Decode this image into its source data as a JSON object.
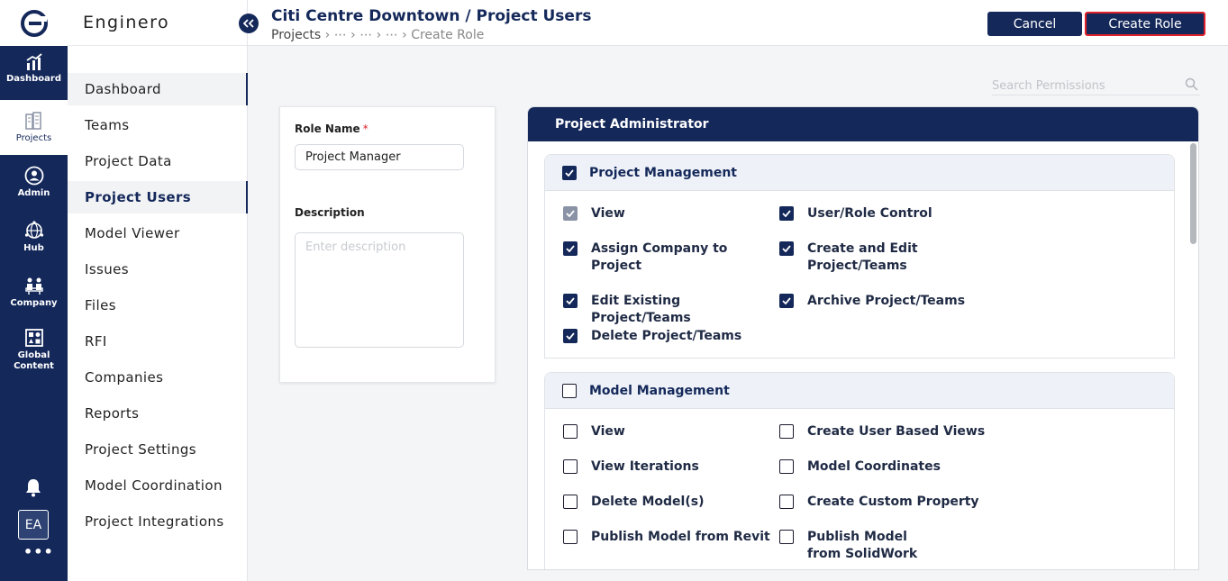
{
  "rail": {
    "items": [
      {
        "label": "Dashboard",
        "icon": "dashboard-chart-icon"
      },
      {
        "label": "Projects",
        "icon": "projects-buildings-icon"
      },
      {
        "label": "Admin",
        "icon": "admin-user-icon"
      },
      {
        "label": "Hub",
        "icon": "hub-globe-icon"
      },
      {
        "label": "Company",
        "icon": "company-people-icon"
      },
      {
        "label": "Global Content",
        "icon": "global-content-icon"
      }
    ],
    "avatar": "EA",
    "more": "•••"
  },
  "sidebar": {
    "brand": "Enginero",
    "items": [
      {
        "label": "Dashboard"
      },
      {
        "label": "Teams"
      },
      {
        "label": "Project Data"
      },
      {
        "label": "Project Users"
      },
      {
        "label": "Model Viewer"
      },
      {
        "label": "Issues"
      },
      {
        "label": "Files"
      },
      {
        "label": "RFI"
      },
      {
        "label": "Companies"
      },
      {
        "label": "Reports"
      },
      {
        "label": "Project Settings"
      },
      {
        "label": "Model Coordination"
      },
      {
        "label": "Project Integrations"
      }
    ]
  },
  "header": {
    "title": "Citi Centre Downtown / Project Users",
    "breadcrumb": {
      "root": "Projects",
      "middle": " › ⋯ › ⋯ › ⋯ › ",
      "current": "Create Role"
    },
    "cancel_label": "Cancel",
    "create_label": "Create Role"
  },
  "search": {
    "placeholder": "Search Permissions"
  },
  "role_form": {
    "role_name_label": "Role Name",
    "required_mark": "*",
    "role_name_value": "Project Manager",
    "description_label": "Description",
    "description_placeholder": "Enter description"
  },
  "permissions": {
    "title": "Project Administrator",
    "groups": [
      {
        "name": "Project Management",
        "checked": true,
        "items": [
          {
            "label": "View",
            "checked": true,
            "disabled": true
          },
          {
            "label": "User/Role Control",
            "checked": true
          },
          {
            "label": "Assign Company to Project",
            "checked": true
          },
          {
            "label": "Create and Edit Project/Teams",
            "checked": true
          },
          {
            "label": "Edit Existing Project/Teams",
            "checked": true
          },
          {
            "label": "Archive Project/Teams",
            "checked": true
          },
          {
            "label": "Delete Project/Teams",
            "checked": true
          }
        ]
      },
      {
        "name": "Model Management",
        "checked": false,
        "items": [
          {
            "label": "View",
            "checked": false
          },
          {
            "label": "Create User Based Views",
            "checked": false
          },
          {
            "label": "View Iterations",
            "checked": false
          },
          {
            "label": "Model Coordinates",
            "checked": false
          },
          {
            "label": "Delete Model(s)",
            "checked": false
          },
          {
            "label": "Create Custom Property",
            "checked": false
          },
          {
            "label": "Publish Model from Revit",
            "checked": false
          },
          {
            "label": "Publish Model from SolidWork",
            "checked": false
          }
        ]
      }
    ]
  },
  "colors": {
    "navy": "#14285a",
    "accent_red": "#e0202a",
    "group_bg": "#eef2f8"
  }
}
